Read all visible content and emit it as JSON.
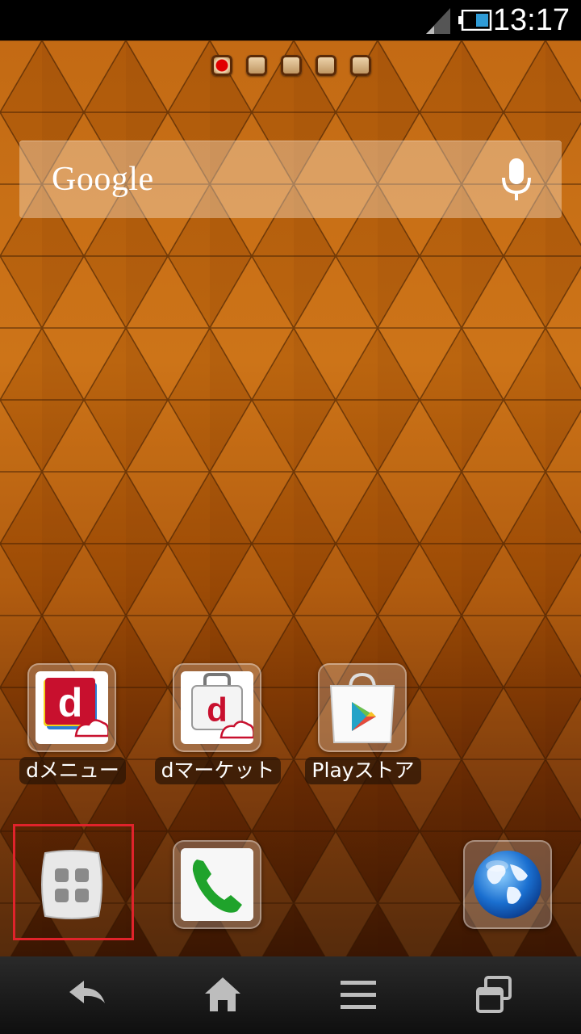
{
  "status_bar": {
    "time": "13:17",
    "battery_icon": "battery-icon",
    "signal_icon": "signal-icon"
  },
  "home": {
    "page_count": 5,
    "active_page": 1,
    "search": {
      "logo": "Google",
      "mic_icon": "microphone-icon"
    },
    "apps": [
      {
        "label": "dメニュー",
        "icon": "d-menu-icon"
      },
      {
        "label": "dマーケット",
        "icon": "d-market-icon"
      },
      {
        "label": "Playストア",
        "icon": "play-store-icon"
      }
    ],
    "dock": [
      {
        "name": "app-drawer",
        "icon": "app-drawer-icon"
      },
      {
        "name": "phone",
        "icon": "phone-icon"
      },
      {
        "name": "browser",
        "icon": "globe-icon"
      }
    ]
  },
  "nav_bar": {
    "back_icon": "back-icon",
    "home_icon": "home-icon",
    "menu_icon": "menu-icon",
    "recents_icon": "recents-icon"
  },
  "colors": {
    "highlight": "#e0232b",
    "wallpaper": "#c56b10",
    "d_red": "#c8102e"
  }
}
